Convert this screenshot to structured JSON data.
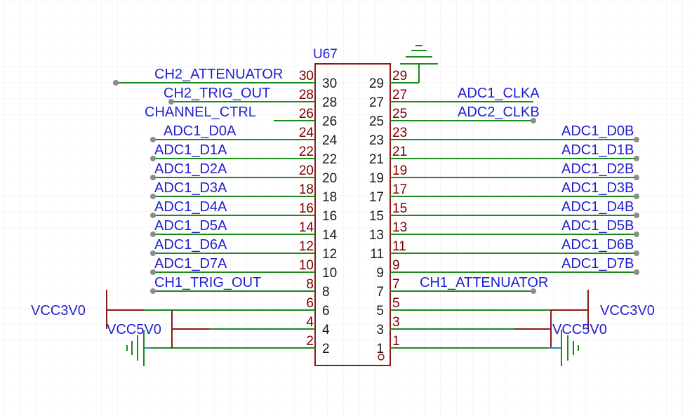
{
  "component": {
    "designator": "U67",
    "left_inner_pins": [
      "30",
      "28",
      "26",
      "24",
      "22",
      "20",
      "18",
      "16",
      "14",
      "12",
      "10",
      "8",
      "6",
      "4",
      "2"
    ],
    "right_inner_pins": [
      "29",
      "27",
      "25",
      "23",
      "21",
      "19",
      "17",
      "15",
      "13",
      "11",
      "9",
      "7",
      "5",
      "3",
      "1"
    ],
    "left_outer_pins": [
      "30",
      "28",
      "26",
      "24",
      "22",
      "20",
      "18",
      "16",
      "14",
      "12",
      "10",
      "8",
      "6",
      "4",
      "2"
    ],
    "right_outer_pins": [
      "29",
      "27",
      "25",
      "23",
      "21",
      "19",
      "17",
      "15",
      "13",
      "11",
      "9",
      "7",
      "5",
      "3",
      "1"
    ]
  },
  "nets": {
    "left": [
      "CH2_ATTENUATOR",
      "CH2_TRIG_OUT",
      "CHANNEL_CTRL",
      "ADC1_D0A",
      "ADC1_D1A",
      "ADC1_D2A",
      "ADC1_D3A",
      "ADC1_D4A",
      "ADC1_D5A",
      "ADC1_D6A",
      "ADC1_D7A",
      "CH1_TRIG_OUT"
    ],
    "right": [
      "ADC1_CLKA",
      "ADC2_CLKB",
      "ADC1_D0B",
      "ADC1_D1B",
      "ADC1_D2B",
      "ADC1_D3B",
      "ADC1_D4B",
      "ADC1_D5B",
      "ADC1_D6B",
      "ADC1_D7B",
      "CH1_ATTENUATOR"
    ]
  },
  "power": {
    "left_3v3": "VCC3V0",
    "left_5v": "VCC5V0",
    "right_3v3": "VCC3V0",
    "right_5v": "VCC5V0"
  },
  "colors": {
    "wire": "#1a8a1a",
    "pin": "#8b1a1a",
    "body": "#8b1a1a",
    "label": "#1f1fcf",
    "grid": "#ececec",
    "junction": "#8c8c8c"
  }
}
